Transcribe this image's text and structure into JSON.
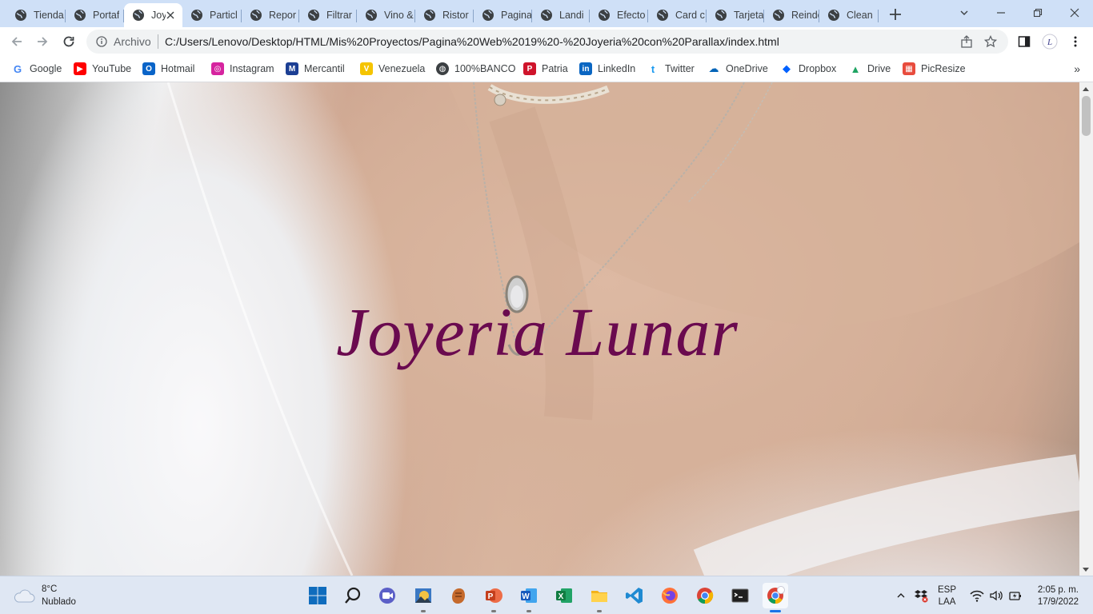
{
  "browser": {
    "tabs": [
      {
        "label": "Tienda"
      },
      {
        "label": "Portaf"
      },
      {
        "label": "Joy"
      },
      {
        "label": "Particl"
      },
      {
        "label": "Repor"
      },
      {
        "label": "Filtrar"
      },
      {
        "label": "Vino &"
      },
      {
        "label": "Ristor"
      },
      {
        "label": "Pagina"
      },
      {
        "label": "Landi"
      },
      {
        "label": "Efecto"
      },
      {
        "label": "Card c"
      },
      {
        "label": "Tarjeta"
      },
      {
        "label": "Reinde"
      },
      {
        "label": "Clean"
      }
    ],
    "omnibox": {
      "scheme": "Archivo",
      "url": "C:/Users/Lenovo/Desktop/HTML/Mis%20Proyectos/Pagina%20Web%2019%20-%20Joyeria%20con%20Parallax/index.html"
    },
    "bookmarks": [
      {
        "label": "Google",
        "icon": "google-icon",
        "color": "#4285f4"
      },
      {
        "label": "YouTube",
        "icon": "youtube-icon",
        "color": "#ff0000"
      },
      {
        "label": "Hotmail",
        "icon": "outlook-icon",
        "color": "#0a64c8"
      },
      {
        "label": "Instagram",
        "icon": "instagram-icon",
        "color": "#d6249f"
      },
      {
        "label": "Mercantil",
        "icon": "mercantil-icon",
        "color": "#1c3f94"
      },
      {
        "label": "Venezuela",
        "icon": "venezuela-icon",
        "color": "#f5c400"
      },
      {
        "label": "100%BANCO",
        "icon": "globe-icon",
        "color": "#3c4043"
      },
      {
        "label": "Patria",
        "icon": "patria-icon",
        "color": "#cf142b"
      },
      {
        "label": "LinkedIn",
        "icon": "linkedin-icon",
        "color": "#0a66c2"
      },
      {
        "label": "Twitter",
        "icon": "twitter-icon",
        "color": "#1d9bf0"
      },
      {
        "label": "OneDrive",
        "icon": "onedrive-icon",
        "color": "#0364b8"
      },
      {
        "label": "Dropbox",
        "icon": "dropbox-icon",
        "color": "#0061ff"
      },
      {
        "label": "Drive",
        "icon": "drive-icon",
        "color": "#1fa463"
      },
      {
        "label": "PicResize",
        "icon": "picresize-icon",
        "color": "#e84c3d"
      }
    ],
    "bookmarks_more": "»"
  },
  "page": {
    "hero_title": "Joyeria Lunar",
    "title_color": "#6a0a4f"
  },
  "taskbar": {
    "weather": {
      "temp": "8°C",
      "condition": "Nublado"
    },
    "language": {
      "line1": "ESP",
      "line2": "LAA"
    },
    "clock": {
      "time": "2:05 p. m.",
      "date": "17/9/2022"
    },
    "apps": [
      "windows-start",
      "search",
      "meet",
      "picture-app",
      "game-app",
      "powerpoint",
      "word",
      "excel",
      "file-explorer",
      "vscode",
      "firefox",
      "chrome",
      "terminal",
      "chrome-profile"
    ]
  }
}
